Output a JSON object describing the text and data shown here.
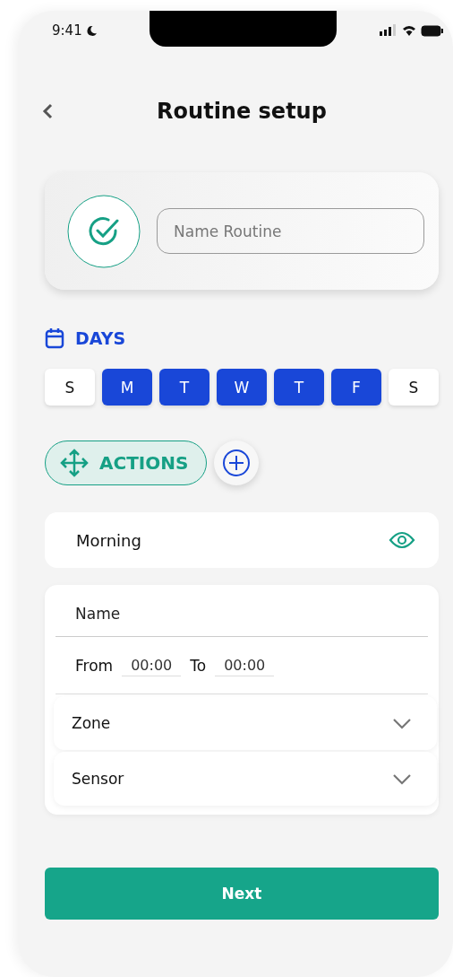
{
  "status_bar": {
    "time": "9:41"
  },
  "header": {
    "title": "Routine setup"
  },
  "routine_name": {
    "placeholder": "Name Routine"
  },
  "days": {
    "label": "DAYS",
    "items": [
      {
        "label": "S",
        "selected": false
      },
      {
        "label": "M",
        "selected": true
      },
      {
        "label": "T",
        "selected": true
      },
      {
        "label": "W",
        "selected": true
      },
      {
        "label": "T",
        "selected": true
      },
      {
        "label": "F",
        "selected": true
      },
      {
        "label": "S",
        "selected": false
      }
    ]
  },
  "actions": {
    "label": "ACTIONS"
  },
  "action_item": {
    "title": "Morning"
  },
  "action_form": {
    "name_placeholder": "Name",
    "from_label": "From",
    "from_value": "00:00",
    "to_label": "To",
    "to_value": "00:00",
    "dropdowns": [
      {
        "label": "Zone",
        "expanded": false
      },
      {
        "label": "Sensor",
        "expanded": false
      }
    ]
  },
  "next_button": {
    "label": "Next"
  }
}
